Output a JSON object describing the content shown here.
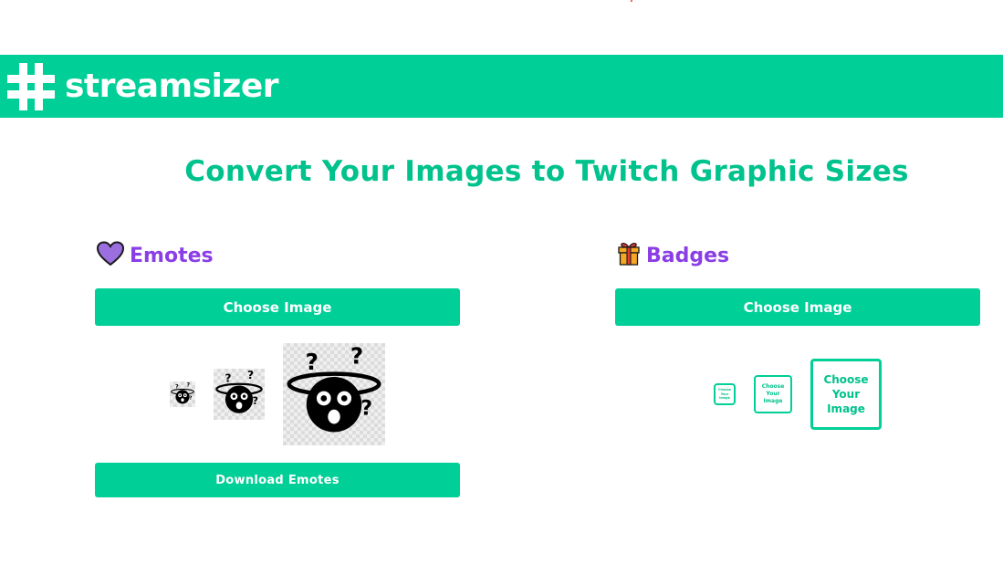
{
  "brand": {
    "name": "streamsizer",
    "accent_color": "#00cf97",
    "heading_color": "#8a3ee6"
  },
  "page": {
    "title": "Convert Your Images to Twitch Graphic Sizes"
  },
  "emotes": {
    "icon": "purple-heart-icon",
    "heading": "Emotes",
    "choose_label": "Choose Image",
    "download_label": "Download Emotes",
    "previews": [
      "small",
      "medium",
      "large"
    ]
  },
  "badges": {
    "icon": "gift-icon",
    "heading": "Badges",
    "choose_label": "Choose Image",
    "placeholder_text": "Choose Your Image"
  }
}
